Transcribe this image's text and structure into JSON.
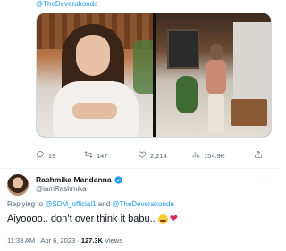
{
  "quoted": {
    "top_mention": "@TheDeverakonda"
  },
  "actions": {
    "replies": "19",
    "retweets": "147",
    "likes": "2,214",
    "views": "154.9K"
  },
  "reply_tweet": {
    "display_name": "Rashmika Mandanna",
    "handle": "@iamRashmika",
    "more": "···",
    "replying_prefix": "Replying to ",
    "replying_mention_1": "@SDM_official1",
    "replying_and": " and ",
    "replying_mention_2": "@TheDeverakonda",
    "text": "Aiyoooo.. don’t over think it babu..",
    "emojis": [
      "rolling-on-floor-laughing",
      "red-heart"
    ],
    "time": "11:33 AM · Apr 6, 2023 · ",
    "views_count": "127.3K",
    "views_label": " Views"
  },
  "colors": {
    "link": "#1d9bf0",
    "muted": "#536471",
    "text": "#0f1419",
    "verified": "#1d9bf0"
  }
}
